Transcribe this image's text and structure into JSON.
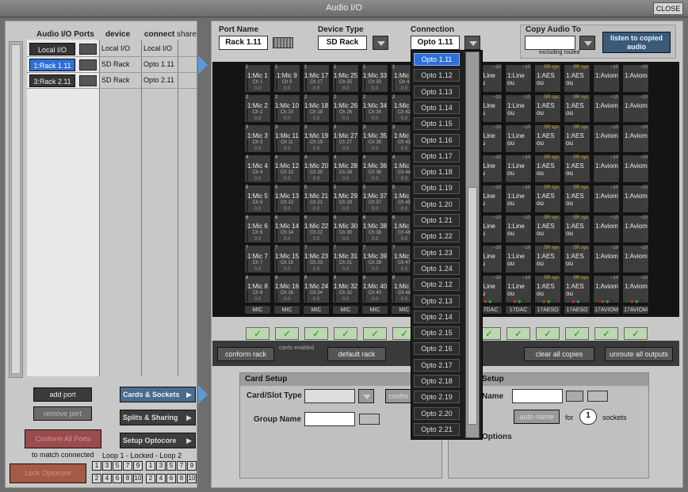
{
  "window": {
    "title": "Audio I/O",
    "close_label": "CLOSE"
  },
  "ports_header": {
    "col1": "Audio I/O Ports",
    "col2": "device",
    "col3": "connect",
    "col4": "share"
  },
  "ports": [
    {
      "name": "Local I/O",
      "device": "Local I/O",
      "connect": "Local I/O",
      "selected": false
    },
    {
      "name": "1:Rack 1.11",
      "device": "SD Rack",
      "connect": "Opto 1.11",
      "selected": true
    },
    {
      "name": "3:Rack 2.11",
      "device": "SD Rack",
      "connect": "Opto 2.11",
      "selected": false
    }
  ],
  "left_buttons": {
    "add_port": "add port",
    "remove_port": "remove port",
    "conform_all": "Conform All Ports",
    "match_connected": "to match connected",
    "lock_optocore": "Lock Optocore",
    "loop_label": "Loop 1 - Locked - Loop 2",
    "loop1_top": [
      "1",
      "3",
      "5",
      "7",
      "9"
    ],
    "loop1_bot": [
      "2",
      "4",
      "6",
      "8",
      "10"
    ],
    "loop2_top": [
      "1",
      "3",
      "5",
      "7",
      "9"
    ],
    "loop2_bot": [
      "2",
      "4",
      "6",
      "8",
      "10"
    ]
  },
  "side_buttons": {
    "cards": "Cards & Sockets",
    "splits": "Splits & Sharing",
    "setup_opto": "Setup Optocore"
  },
  "top": {
    "port_name_label": "Port Name",
    "port_name_value": "Rack 1.11",
    "device_type_label": "Device Type",
    "device_type_value": "SD Rack",
    "connection_label": "Connection",
    "connection_value": "Opto 1.11",
    "copy_label": "Copy Audio To",
    "copy_value": "",
    "excluding": "excluding routed",
    "listen_label": "listen to copied audio"
  },
  "grid": {
    "left_cols": [
      {
        "foot": "MIC",
        "cells": [
          {
            "n": "1",
            "t": "1:Mic 1",
            "c": "Ch 1"
          },
          {
            "n": "2",
            "t": "1:Mic 2",
            "c": "Ch 2"
          },
          {
            "n": "3",
            "t": "1:Mic 3",
            "c": "Ch 3"
          },
          {
            "n": "4",
            "t": "1:Mic 4",
            "c": "Ch 4"
          },
          {
            "n": "5",
            "t": "1:Mic 5",
            "c": "Ch 5"
          },
          {
            "n": "6",
            "t": "1:Mic 6",
            "c": "Ch 6"
          },
          {
            "n": "7",
            "t": "1:Mic 7",
            "c": "Ch 7"
          },
          {
            "n": "8",
            "t": "1:Mic 8",
            "c": "Ch 8"
          }
        ]
      },
      {
        "foot": "MIC",
        "cells": [
          {
            "n": "1",
            "t": "1:Mic 9",
            "c": "Ch 9"
          },
          {
            "n": "2",
            "t": "1:Mic 10",
            "c": "Ch 10"
          },
          {
            "n": "3",
            "t": "1:Mic 11",
            "c": "Ch 11"
          },
          {
            "n": "4",
            "t": "1:Mic 12",
            "c": "Ch 12"
          },
          {
            "n": "5",
            "t": "1:Mic 13",
            "c": "Ch 13"
          },
          {
            "n": "6",
            "t": "1:Mic 14",
            "c": "Ch 14"
          },
          {
            "n": "7",
            "t": "1:Mic 15",
            "c": "Ch 15"
          },
          {
            "n": "8",
            "t": "1:Mic 16",
            "c": "Ch 16"
          }
        ]
      },
      {
        "foot": "MIC",
        "cells": [
          {
            "n": "1",
            "t": "1:Mic 17",
            "c": "Ch 17"
          },
          {
            "n": "2",
            "t": "1:Mic 18",
            "c": "Ch 18"
          },
          {
            "n": "3",
            "t": "1:Mic 19",
            "c": "Ch 19"
          },
          {
            "n": "4",
            "t": "1:Mic 20",
            "c": "Ch 20"
          },
          {
            "n": "5",
            "t": "1:Mic 21",
            "c": "Ch 21"
          },
          {
            "n": "6",
            "t": "1:Mic 22",
            "c": "Ch 22"
          },
          {
            "n": "7",
            "t": "1:Mic 23",
            "c": "Ch 23"
          },
          {
            "n": "8",
            "t": "1:Mic 24",
            "c": "Ch 24"
          }
        ]
      },
      {
        "foot": "MIC",
        "cells": [
          {
            "n": "1",
            "t": "1:Mic 25",
            "c": "Ch 25"
          },
          {
            "n": "2",
            "t": "1:Mic 26",
            "c": "Ch 26"
          },
          {
            "n": "3",
            "t": "1:Mic 27",
            "c": "Ch 27"
          },
          {
            "n": "4",
            "t": "1:Mic 28",
            "c": "Ch 28"
          },
          {
            "n": "5",
            "t": "1:Mic 29",
            "c": "Ch 29"
          },
          {
            "n": "6",
            "t": "1:Mic 30",
            "c": "Ch 30"
          },
          {
            "n": "7",
            "t": "1:Mic 31",
            "c": "Ch 31"
          },
          {
            "n": "8",
            "t": "1:Mic 32",
            "c": "Ch 32"
          }
        ]
      },
      {
        "foot": "MIC",
        "cells": [
          {
            "n": "1",
            "t": "1:Mic 33",
            "c": "Ch 33"
          },
          {
            "n": "2",
            "t": "1:Mic 34",
            "c": "Ch 34"
          },
          {
            "n": "3",
            "t": "1:Mic 35",
            "c": "Ch 35"
          },
          {
            "n": "4",
            "t": "1:Mic 36",
            "c": "Ch 36"
          },
          {
            "n": "5",
            "t": "1:Mic 37",
            "c": "Ch 37"
          },
          {
            "n": "6",
            "t": "1:Mic 38",
            "c": "Ch 38"
          },
          {
            "n": "7",
            "t": "1:Mic 39",
            "c": "Ch 39"
          },
          {
            "n": "8",
            "t": "1:Mic 40",
            "c": "Ch 40"
          }
        ]
      },
      {
        "foot": "MIC",
        "cells": [
          {
            "n": "1",
            "t": "1:Mic 4",
            "c": "Ch 4"
          },
          {
            "n": "2",
            "t": "1:Mic 4",
            "c": "Ch 42"
          },
          {
            "n": "3",
            "t": "1:Mic 4",
            "c": "Ch 43"
          },
          {
            "n": "4",
            "t": "1:Mic 4",
            "c": "Ch 44"
          },
          {
            "n": "5",
            "t": "1:Mic 4",
            "c": "Ch 45"
          },
          {
            "n": "6",
            "t": "1:Mic 4",
            "c": "Ch 46"
          },
          {
            "n": "7",
            "t": "1:Mic 4",
            "c": "Ch 47"
          },
          {
            "n": "8",
            "t": "1:Mic 4",
            "c": "Ch 48"
          }
        ]
      }
    ],
    "right_cols": [
      {
        "foot": "17DAC",
        "t": "1:Line ou",
        "y": ""
      },
      {
        "foot": "17DAC",
        "t": "1:Line ou",
        "y": ""
      },
      {
        "foot": "17AESO",
        "t": "1:AES ou",
        "y": "SR sys"
      },
      {
        "foot": "17AESO",
        "t": "1:AES ou",
        "y": "SR sys"
      },
      {
        "foot": "17AVIOM",
        "t": "1:Aviom",
        "y": ""
      },
      {
        "foot": "17AVIOM",
        "t": "1:Aviom",
        "y": ""
      }
    ],
    "val": "0.0",
    "right_n": "~10",
    "check": "✓"
  },
  "strip": {
    "conform": "conform rack",
    "cards_enabled": "cards enabled",
    "default": "default rack",
    "clear_copies": "clear all copies",
    "unroute": "unroute all outputs"
  },
  "card_setup": {
    "title": "Card Setup",
    "card_slot_type": "Card/Slot Type",
    "group_name": "Group Name",
    "conform": "confor"
  },
  "other_setup": {
    "title": "Setup",
    "name_label": "Name",
    "auto_name": "auto-name",
    "for": "for",
    "count": "1",
    "sockets": "sockets",
    "options": "Options"
  },
  "dropdown": {
    "items": [
      "Opto 1.11",
      "Opto 1.12",
      "Opto 1.13",
      "Opto 1.14",
      "Opto 1.15",
      "Opto 1.16",
      "Opto 1.17",
      "Opto 1.18",
      "Opto 1.19",
      "Opto 1.20",
      "Opto 1.21",
      "Opto 1.22",
      "Opto 1.23",
      "Opto 1.24",
      "Opto 2.12",
      "Opto 2.13",
      "Opto 2.14",
      "Opto 2.15",
      "Opto 2.16",
      "Opto 2.17",
      "Opto 2.18",
      "Opto 2.19",
      "Opto 2.20",
      "Opto 2.21"
    ],
    "selected": "Opto 1.11"
  }
}
